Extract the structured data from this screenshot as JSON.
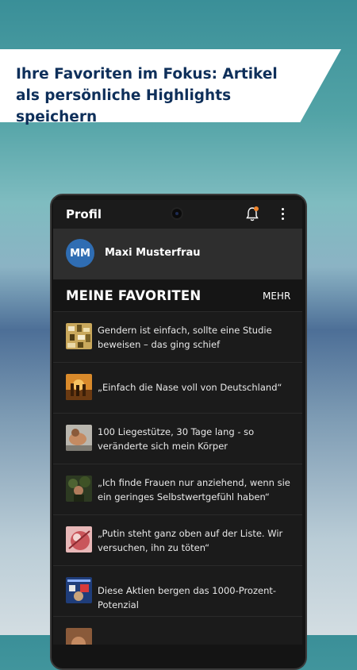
{
  "banner": {
    "text": "Ihre Favoriten im Fokus: Artikel als persönliche Highlights speichern"
  },
  "appbar": {
    "title": "Profil",
    "icons": [
      "bell-icon",
      "more-vertical-icon"
    ],
    "notification_color": "#f0852d"
  },
  "profile": {
    "initials": "MM",
    "name": "Maxi Musterfrau",
    "avatar_color": "#2f6db3"
  },
  "favorites": {
    "title": "MEINE FAVORITEN",
    "more_label": "MEHR",
    "items": [
      {
        "title": "Gendern ist einfach, sollte eine Studie beweisen – das ging schief"
      },
      {
        "title": "„Einfach die Nase voll von Deutschland“"
      },
      {
        "title": "100 Liegestütze, 30 Tage lang - so veränderte sich mein Körper"
      },
      {
        "title": "„Ich finde Frauen nur anziehend, wenn sie ein geringes Selbstwertgefühl haben“"
      },
      {
        "title": "„Putin steht ganz oben auf der Liste. Wir versuchen, ihn zu töten“"
      },
      {
        "title": "Diese Aktien bergen das 1000-Prozent-Potenzial"
      }
    ]
  }
}
